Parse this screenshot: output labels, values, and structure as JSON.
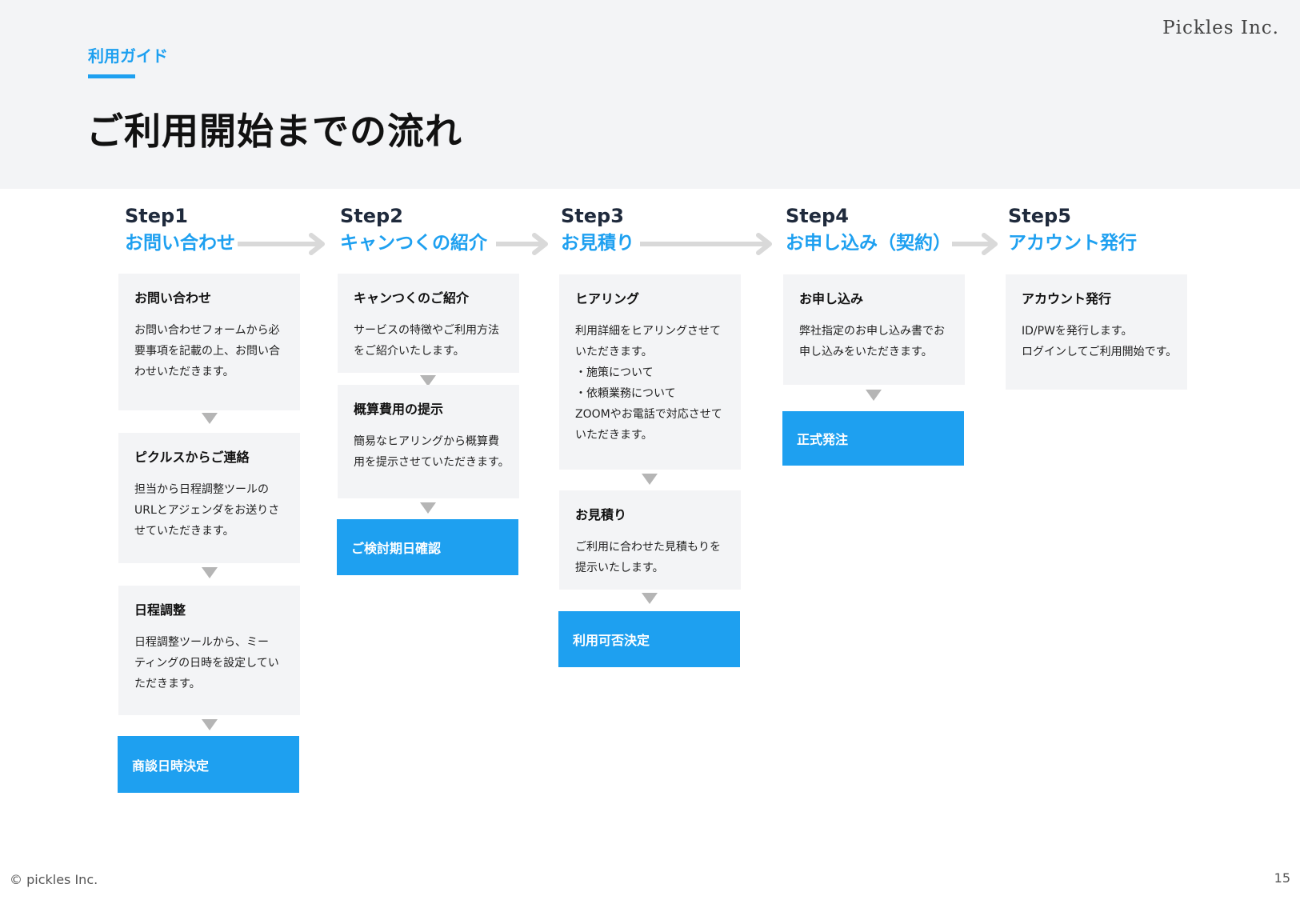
{
  "header": {
    "company": "Pickles Inc.",
    "section_label": "利用ガイド",
    "title": "ご利用開始までの流れ"
  },
  "steps": [
    {
      "num": "Step1",
      "name": "お問い合わせ",
      "cards": [
        {
          "title": "お問い合わせ",
          "lines": [
            "お問い合わせフォームから必",
            "要事項を記載の上、お問い合",
            "わせいただきます。"
          ]
        },
        {
          "title": "ピクルスからご連絡",
          "lines": [
            "担当から日程調整ツールの",
            "URLとアジェンダをお送りさ",
            "せていただきます。"
          ]
        },
        {
          "title": "日程調整",
          "lines": [
            "日程調整ツールから、ミー",
            "ティングの日時を設定してい",
            "ただきます。"
          ]
        }
      ],
      "result": "商談日時決定"
    },
    {
      "num": "Step2",
      "name": "キャンつくの紹介",
      "cards": [
        {
          "title": "キャンつくのご紹介",
          "lines": [
            "サービスの特徴やご利用方法",
            "をご紹介いたします。"
          ]
        },
        {
          "title": "概算費用の提示",
          "lines": [
            "簡易なヒアリングから概算費",
            "用を提示させていただきます。"
          ]
        }
      ],
      "result": "ご検討期日確認"
    },
    {
      "num": "Step3",
      "name": "お見積り",
      "cards": [
        {
          "title": "ヒアリング",
          "lines": [
            "利用詳細をヒアリングさせて",
            "いただきます。",
            "・施策について",
            "・依頼業務について",
            "ZOOMやお電話で対応させて",
            "いただきます。"
          ]
        },
        {
          "title": "お見積り",
          "lines": [
            "ご利用に合わせた見積もりを",
            "提示いたします。"
          ]
        }
      ],
      "result": "利用可否決定"
    },
    {
      "num": "Step4",
      "name": "お申し込み（契約）",
      "cards": [
        {
          "title": "お申し込み",
          "lines": [
            "弊社指定のお申し込み書でお",
            "申し込みをいただきます。"
          ]
        }
      ],
      "result": "正式発注"
    },
    {
      "num": "Step5",
      "name": "アカウント発行",
      "cards": [
        {
          "title": "アカウント発行",
          "lines": [
            "ID/PWを発行します。",
            "ログインしてご利用開始です。"
          ]
        }
      ],
      "result": ""
    }
  ],
  "footer": {
    "copyright": "© pickles Inc.",
    "page_number": "15"
  },
  "colors": {
    "accent": "#1ea0f0",
    "card_bg": "#f3f4f6",
    "arrow": "#d9d9d9",
    "down_marker": "#b5b5b5"
  },
  "icons": {
    "flow_arrow": "arrow-right-icon",
    "down_marker": "triangle-down-icon"
  }
}
